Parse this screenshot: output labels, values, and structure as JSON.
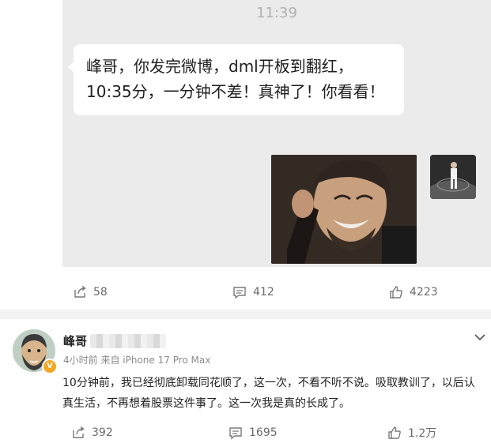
{
  "chat": {
    "time": "11:39",
    "message": "峰哥，你发完微博，dml开板到翻红，10:35分，一分钟不差！真神了！你看看！"
  },
  "top_actions": {
    "repost": "58",
    "comment": "412",
    "like": "4223"
  },
  "post": {
    "username": "峰哥",
    "time_ago": "4小时前",
    "source": "来自 iPhone 17 Pro Max",
    "text": "10分钟前，我已经彻底卸载同花顺了，这一次，不看不听不说。吸取教训了，以后认真生活，不再想着股票这件事了。这一次我是真的长成了。",
    "badge": "V",
    "actions": {
      "repost": "392",
      "comment": "1695",
      "like": "1.2万"
    }
  },
  "colors": {
    "page_bg": "#ffffff",
    "chat_bg": "#ebebeb",
    "divider": "#f3f3f3",
    "badge": "#f5a623"
  }
}
